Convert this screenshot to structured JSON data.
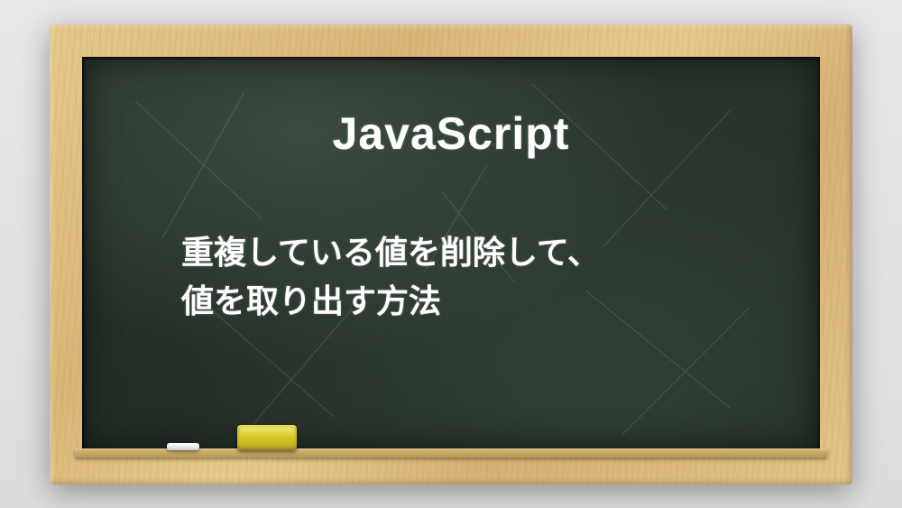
{
  "title": "JavaScript",
  "subtitle_line1": "重複している値を削除して、",
  "subtitle_line2": "値を取り出す方法"
}
